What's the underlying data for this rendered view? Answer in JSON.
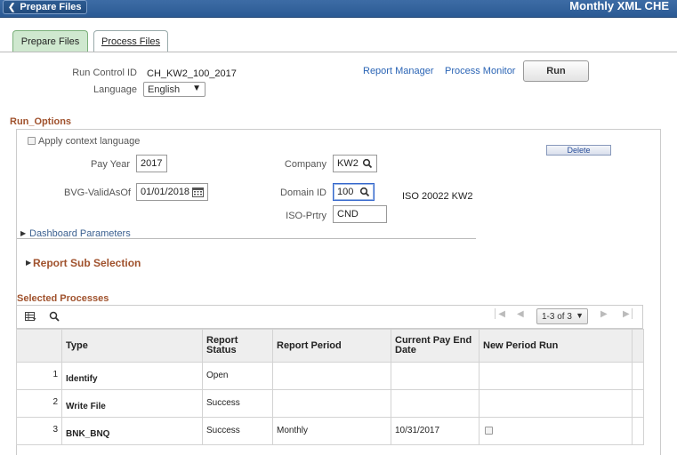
{
  "header": {
    "back_label": "Prepare Files",
    "title": "Monthly XML CHE"
  },
  "tabs": [
    {
      "label": "Prepare Files",
      "active": true
    },
    {
      "label": "Process Files",
      "active": false
    }
  ],
  "run_control": {
    "label": "Run Control ID",
    "value": "CH_KW2_100_2017"
  },
  "language": {
    "label": "Language",
    "value": "English"
  },
  "links": {
    "report_manager": "Report Manager",
    "process_monitor": "Process Monitor"
  },
  "run_button": "Run",
  "run_options": {
    "title": "Run_Options",
    "apply_context_language": "Apply context language",
    "pay_year": {
      "label": "Pay Year",
      "value": "2017"
    },
    "company": {
      "label": "Company",
      "value": "KW2"
    },
    "bvg_valid_as_of": {
      "label": "BVG-ValidAsOf",
      "value": "01/01/2018"
    },
    "domain_id": {
      "label": "Domain ID",
      "value": "100",
      "description": "ISO 20022 KW2"
    },
    "iso_prtry": {
      "label": "ISO-Prtry",
      "value": "CND"
    },
    "delete_button": "Delete",
    "dashboard_parameters": "Dashboard Parameters",
    "report_sub_selection": "Report Sub Selection"
  },
  "selected_processes": {
    "title": "Selected Processes",
    "pager": "1-3 of 3",
    "columns": [
      "Type",
      "Report Status",
      "Report Period",
      "Current Pay End Date",
      "New Period Run"
    ],
    "rows": [
      {
        "num": "1",
        "type": "Identify",
        "status": "Open",
        "period": "",
        "date": "",
        "new_period_run": false
      },
      {
        "num": "2",
        "type": "Write File",
        "status": "Success",
        "period": "",
        "date": "",
        "new_period_run": false
      },
      {
        "num": "3",
        "type": "BNK_BNQ",
        "status": "Success",
        "period": "Monthly",
        "date": "10/31/2017",
        "new_period_run": true
      }
    ]
  },
  "colors": {
    "header": "#2b5a94",
    "section_title": "#a0522d",
    "link": "#2a64b5",
    "active_tab": "#cfe8cf"
  },
  "icons": [
    "chevron-left-icon",
    "dropdown-arrow-icon",
    "search-icon",
    "calendar-icon",
    "grid-settings-icon",
    "first-page-icon",
    "previous-page-icon",
    "next-page-icon",
    "last-page-icon",
    "expand-triangle-icon"
  ]
}
